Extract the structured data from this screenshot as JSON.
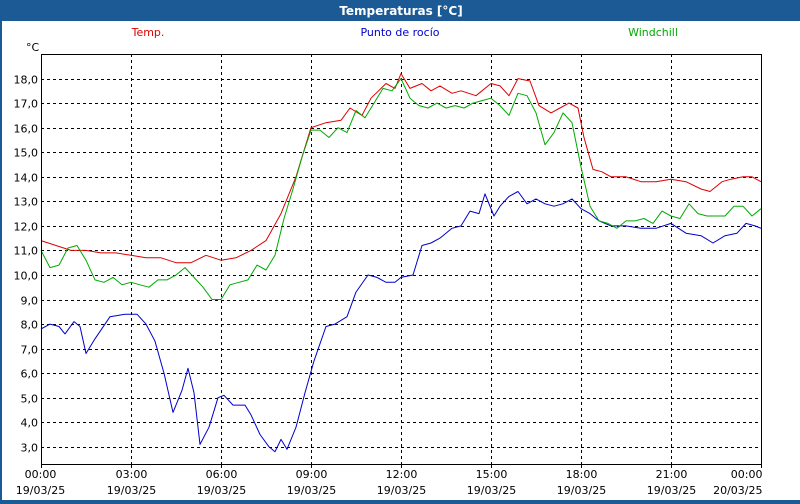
{
  "window": {
    "title": "Temperaturas [°C]"
  },
  "chart_data": {
    "type": "line",
    "title": "Temperaturas [°C]",
    "ylabel": "°C",
    "ylim": [
      2.3,
      19.0
    ],
    "xlim": [
      0,
      24
    ],
    "grid": true,
    "legend_placement": "top",
    "yticks": [
      "18,0",
      "17,0",
      "16,0",
      "15,0",
      "14,0",
      "13,0",
      "12,0",
      "11,0",
      "10,0",
      "9,0",
      "8,0",
      "7,0",
      "6,0",
      "5,0",
      "4,0",
      "3,0"
    ],
    "ytick_values": [
      18,
      17,
      16,
      15,
      14,
      13,
      12,
      11,
      10,
      9,
      8,
      7,
      6,
      5,
      4,
      3
    ],
    "xticks": [
      {
        "time": "00:00",
        "date": "19/03/25",
        "h": 0
      },
      {
        "time": "03:00",
        "date": "19/03/25",
        "h": 3
      },
      {
        "time": "06:00",
        "date": "19/03/25",
        "h": 6
      },
      {
        "time": "09:00",
        "date": "19/03/25",
        "h": 9
      },
      {
        "time": "12:00",
        "date": "19/03/25",
        "h": 12
      },
      {
        "time": "15:00",
        "date": "19/03/25",
        "h": 15
      },
      {
        "time": "18:00",
        "date": "19/03/25",
        "h": 18
      },
      {
        "time": "21:00",
        "date": "19/03/25",
        "h": 21
      },
      {
        "time": "00:00",
        "date": "20/03/25",
        "h": 24
      }
    ],
    "series": [
      {
        "name": "Temp.",
        "color": "#dd0000",
        "points": [
          [
            0,
            11.4
          ],
          [
            0.5,
            11.2
          ],
          [
            1,
            11.0
          ],
          [
            1.5,
            11.0
          ],
          [
            2,
            10.9
          ],
          [
            2.5,
            10.9
          ],
          [
            3,
            10.8
          ],
          [
            3.5,
            10.7
          ],
          [
            4,
            10.7
          ],
          [
            4.5,
            10.5
          ],
          [
            5,
            10.5
          ],
          [
            5.5,
            10.8
          ],
          [
            6,
            10.6
          ],
          [
            6.5,
            10.7
          ],
          [
            7,
            11.0
          ],
          [
            7.5,
            11.4
          ],
          [
            8,
            12.5
          ],
          [
            8.5,
            14.0
          ],
          [
            8.8,
            15.2
          ],
          [
            9,
            16.0
          ],
          [
            9.5,
            16.2
          ],
          [
            10,
            16.3
          ],
          [
            10.3,
            16.8
          ],
          [
            10.7,
            16.5
          ],
          [
            11,
            17.2
          ],
          [
            11.5,
            17.8
          ],
          [
            11.8,
            17.6
          ],
          [
            12,
            18.2
          ],
          [
            12.3,
            17.6
          ],
          [
            12.7,
            17.8
          ],
          [
            13,
            17.5
          ],
          [
            13.3,
            17.7
          ],
          [
            13.7,
            17.4
          ],
          [
            14,
            17.5
          ],
          [
            14.5,
            17.3
          ],
          [
            15,
            17.8
          ],
          [
            15.3,
            17.7
          ],
          [
            15.6,
            17.3
          ],
          [
            15.9,
            18.0
          ],
          [
            16.3,
            17.9
          ],
          [
            16.6,
            16.9
          ],
          [
            17,
            16.6
          ],
          [
            17.3,
            16.8
          ],
          [
            17.6,
            17.0
          ],
          [
            17.9,
            16.8
          ],
          [
            18.1,
            15.6
          ],
          [
            18.4,
            14.3
          ],
          [
            18.7,
            14.2
          ],
          [
            19,
            14.0
          ],
          [
            19.5,
            14.0
          ],
          [
            20,
            13.8
          ],
          [
            20.5,
            13.8
          ],
          [
            21,
            13.9
          ],
          [
            21.5,
            13.8
          ],
          [
            22,
            13.5
          ],
          [
            22.3,
            13.4
          ],
          [
            22.7,
            13.8
          ],
          [
            23,
            13.9
          ],
          [
            23.4,
            14.0
          ],
          [
            23.7,
            14.0
          ],
          [
            24,
            13.8
          ]
        ]
      },
      {
        "name": "Punto de rocío",
        "color": "#0000cc",
        "points": [
          [
            0,
            7.8
          ],
          [
            0.3,
            8.0
          ],
          [
            0.6,
            7.9
          ],
          [
            0.8,
            7.6
          ],
          [
            1.1,
            8.1
          ],
          [
            1.3,
            7.9
          ],
          [
            1.5,
            6.8
          ],
          [
            1.8,
            7.4
          ],
          [
            2.3,
            8.3
          ],
          [
            2.8,
            8.4
          ],
          [
            3.2,
            8.4
          ],
          [
            3.5,
            8.0
          ],
          [
            3.8,
            7.3
          ],
          [
            4.1,
            6.0
          ],
          [
            4.4,
            4.4
          ],
          [
            4.7,
            5.3
          ],
          [
            4.9,
            6.2
          ],
          [
            5.1,
            5.2
          ],
          [
            5.3,
            3.1
          ],
          [
            5.6,
            3.8
          ],
          [
            5.9,
            5.0
          ],
          [
            6.1,
            5.1
          ],
          [
            6.4,
            4.7
          ],
          [
            6.8,
            4.7
          ],
          [
            7.0,
            4.3
          ],
          [
            7.3,
            3.5
          ],
          [
            7.6,
            3.0
          ],
          [
            7.8,
            2.8
          ],
          [
            8.0,
            3.3
          ],
          [
            8.2,
            2.9
          ],
          [
            8.5,
            3.8
          ],
          [
            8.8,
            5.2
          ],
          [
            9.1,
            6.5
          ],
          [
            9.5,
            7.9
          ],
          [
            9.8,
            8.0
          ],
          [
            10.2,
            8.3
          ],
          [
            10.5,
            9.3
          ],
          [
            10.9,
            10.0
          ],
          [
            11.2,
            9.9
          ],
          [
            11.5,
            9.7
          ],
          [
            11.8,
            9.7
          ],
          [
            12.0,
            9.9
          ],
          [
            12.4,
            10.0
          ],
          [
            12.7,
            11.2
          ],
          [
            13.0,
            11.3
          ],
          [
            13.3,
            11.5
          ],
          [
            13.7,
            11.9
          ],
          [
            14.0,
            12.0
          ],
          [
            14.3,
            12.6
          ],
          [
            14.6,
            12.5
          ],
          [
            14.8,
            13.3
          ],
          [
            15.1,
            12.4
          ],
          [
            15.3,
            12.8
          ],
          [
            15.6,
            13.2
          ],
          [
            15.9,
            13.4
          ],
          [
            16.2,
            12.9
          ],
          [
            16.5,
            13.1
          ],
          [
            16.8,
            12.9
          ],
          [
            17.1,
            12.8
          ],
          [
            17.4,
            12.9
          ],
          [
            17.7,
            13.1
          ],
          [
            18.0,
            12.7
          ],
          [
            18.3,
            12.5
          ],
          [
            18.6,
            12.2
          ],
          [
            19.0,
            12.0
          ],
          [
            19.5,
            12.0
          ],
          [
            20,
            11.9
          ],
          [
            20.5,
            11.9
          ],
          [
            21,
            12.1
          ],
          [
            21.5,
            11.7
          ],
          [
            22,
            11.6
          ],
          [
            22.4,
            11.3
          ],
          [
            22.8,
            11.6
          ],
          [
            23.2,
            11.7
          ],
          [
            23.5,
            12.1
          ],
          [
            23.8,
            12.0
          ],
          [
            24,
            11.9
          ]
        ]
      },
      {
        "name": "Windchill",
        "color": "#00aa00",
        "points": [
          [
            0,
            11.0
          ],
          [
            0.3,
            10.3
          ],
          [
            0.6,
            10.4
          ],
          [
            0.9,
            11.1
          ],
          [
            1.2,
            11.2
          ],
          [
            1.5,
            10.6
          ],
          [
            1.8,
            9.8
          ],
          [
            2.1,
            9.7
          ],
          [
            2.4,
            9.9
          ],
          [
            2.7,
            9.6
          ],
          [
            3.0,
            9.7
          ],
          [
            3.3,
            9.6
          ],
          [
            3.6,
            9.5
          ],
          [
            3.9,
            9.8
          ],
          [
            4.2,
            9.8
          ],
          [
            4.5,
            10.0
          ],
          [
            4.8,
            10.3
          ],
          [
            5.1,
            9.9
          ],
          [
            5.4,
            9.5
          ],
          [
            5.7,
            9.0
          ],
          [
            6.0,
            9.0
          ],
          [
            6.3,
            9.6
          ],
          [
            6.6,
            9.7
          ],
          [
            6.9,
            9.8
          ],
          [
            7.2,
            10.4
          ],
          [
            7.5,
            10.2
          ],
          [
            7.8,
            10.8
          ],
          [
            8.1,
            12.3
          ],
          [
            8.4,
            13.5
          ],
          [
            8.7,
            14.8
          ],
          [
            9.0,
            15.9
          ],
          [
            9.3,
            15.9
          ],
          [
            9.6,
            15.6
          ],
          [
            9.9,
            16.0
          ],
          [
            10.2,
            15.8
          ],
          [
            10.5,
            16.7
          ],
          [
            10.8,
            16.4
          ],
          [
            11.1,
            17.0
          ],
          [
            11.4,
            17.6
          ],
          [
            11.7,
            17.5
          ],
          [
            12.0,
            18.0
          ],
          [
            12.3,
            17.2
          ],
          [
            12.6,
            16.9
          ],
          [
            12.9,
            16.8
          ],
          [
            13.2,
            17.0
          ],
          [
            13.5,
            16.8
          ],
          [
            13.8,
            16.9
          ],
          [
            14.1,
            16.8
          ],
          [
            14.4,
            17.0
          ],
          [
            14.7,
            17.1
          ],
          [
            15.0,
            17.2
          ],
          [
            15.3,
            16.9
          ],
          [
            15.6,
            16.5
          ],
          [
            15.9,
            17.4
          ],
          [
            16.2,
            17.3
          ],
          [
            16.5,
            16.6
          ],
          [
            16.8,
            15.3
          ],
          [
            17.1,
            15.8
          ],
          [
            17.4,
            16.6
          ],
          [
            17.7,
            16.2
          ],
          [
            18.0,
            14.4
          ],
          [
            18.3,
            12.8
          ],
          [
            18.6,
            12.2
          ],
          [
            18.9,
            12.1
          ],
          [
            19.2,
            11.9
          ],
          [
            19.5,
            12.2
          ],
          [
            19.8,
            12.2
          ],
          [
            20.1,
            12.3
          ],
          [
            20.4,
            12.1
          ],
          [
            20.7,
            12.6
          ],
          [
            21.0,
            12.4
          ],
          [
            21.3,
            12.3
          ],
          [
            21.6,
            12.9
          ],
          [
            21.9,
            12.5
          ],
          [
            22.2,
            12.4
          ],
          [
            22.5,
            12.4
          ],
          [
            22.8,
            12.4
          ],
          [
            23.1,
            12.8
          ],
          [
            23.4,
            12.8
          ],
          [
            23.7,
            12.4
          ],
          [
            24,
            12.7
          ]
        ]
      }
    ]
  }
}
